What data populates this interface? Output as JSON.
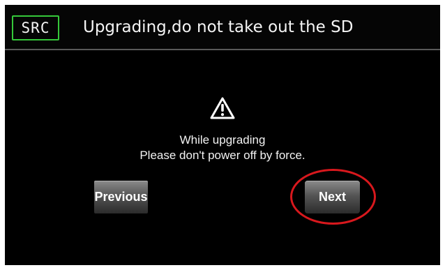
{
  "header": {
    "source_button_label": "SRC",
    "title": "Upgrading,do not take out the SD"
  },
  "content": {
    "icon": "warning-triangle-icon",
    "message_line_1": "While upgrading",
    "message_line_2": "Please don't power off by force."
  },
  "buttons": {
    "previous_label": "Previous",
    "next_label": "Next"
  },
  "colors": {
    "background": "#000000",
    "accent_border": "#35c83a",
    "annotation_highlight": "#d8181d",
    "button_top": "#8b8b8b",
    "button_bottom": "#2b2b2b"
  }
}
